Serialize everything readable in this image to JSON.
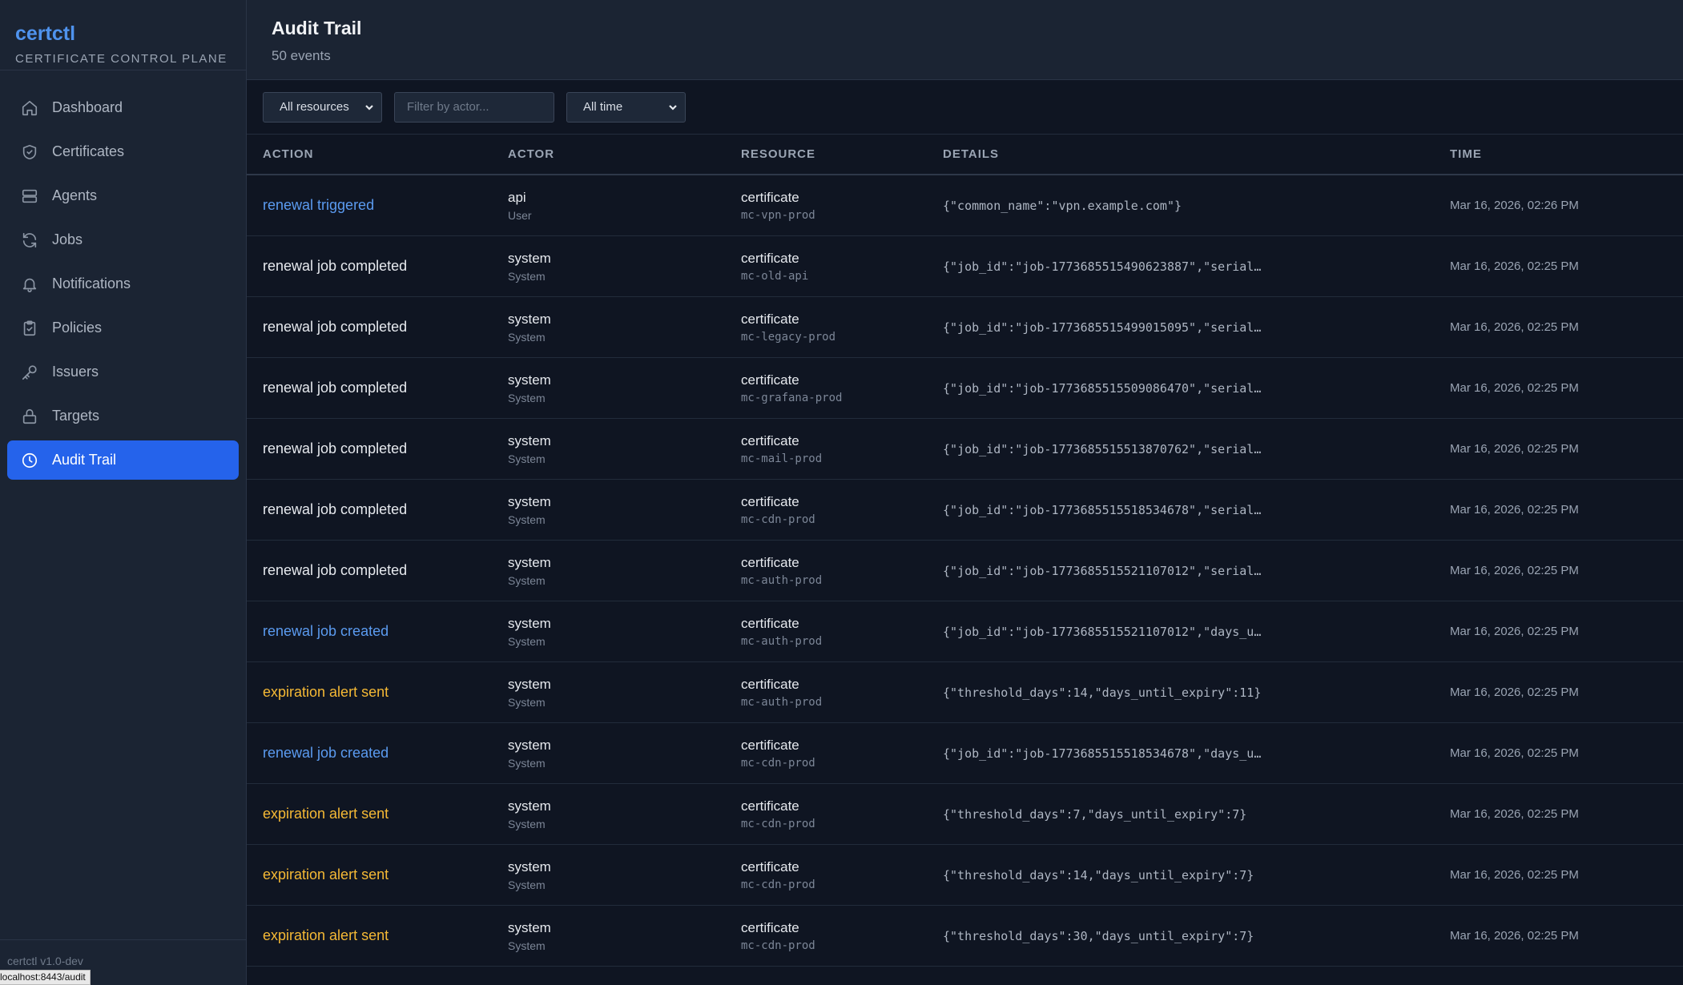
{
  "brand": {
    "title": "certctl",
    "subtitle": "CERTIFICATE CONTROL PLANE"
  },
  "sidebar": {
    "items": [
      {
        "label": "Dashboard",
        "icon": "home-icon",
        "active": false
      },
      {
        "label": "Certificates",
        "icon": "shield-icon",
        "active": false
      },
      {
        "label": "Agents",
        "icon": "server-icon",
        "active": false
      },
      {
        "label": "Jobs",
        "icon": "refresh-icon",
        "active": false
      },
      {
        "label": "Notifications",
        "icon": "bell-icon",
        "active": false
      },
      {
        "label": "Policies",
        "icon": "clipboard-icon",
        "active": false
      },
      {
        "label": "Issuers",
        "icon": "key-icon",
        "active": false
      },
      {
        "label": "Targets",
        "icon": "lock-icon",
        "active": false
      },
      {
        "label": "Audit Trail",
        "icon": "clock-icon",
        "active": true
      }
    ],
    "version": "certctl v1.0-dev",
    "status_url": "localhost:8443/audit"
  },
  "header": {
    "title": "Audit Trail",
    "subtitle": "50 events"
  },
  "filters": {
    "resource_value": "All resources",
    "actor_placeholder": "Filter by actor...",
    "time_value": "All time"
  },
  "table": {
    "columns": [
      "ACTION",
      "ACTOR",
      "RESOURCE",
      "DETAILS",
      "TIME"
    ],
    "rows": [
      {
        "action": "renewal triggered",
        "tone": "blue",
        "actor": "api",
        "actor_type": "User",
        "resource": "certificate",
        "resource_id": "mc-vpn-prod",
        "details": "{\"common_name\":\"vpn.example.com\"}",
        "time": "Mar 16, 2026, 02:26 PM"
      },
      {
        "action": "renewal job completed",
        "tone": "white",
        "actor": "system",
        "actor_type": "System",
        "resource": "certificate",
        "resource_id": "mc-old-api",
        "details": "{\"job_id\":\"job-1773685515490623887\",\"serial…",
        "time": "Mar 16, 2026, 02:25 PM"
      },
      {
        "action": "renewal job completed",
        "tone": "white",
        "actor": "system",
        "actor_type": "System",
        "resource": "certificate",
        "resource_id": "mc-legacy-prod",
        "details": "{\"job_id\":\"job-1773685515499015095\",\"serial…",
        "time": "Mar 16, 2026, 02:25 PM"
      },
      {
        "action": "renewal job completed",
        "tone": "white",
        "actor": "system",
        "actor_type": "System",
        "resource": "certificate",
        "resource_id": "mc-grafana-prod",
        "details": "{\"job_id\":\"job-1773685515509086470\",\"serial…",
        "time": "Mar 16, 2026, 02:25 PM"
      },
      {
        "action": "renewal job completed",
        "tone": "white",
        "actor": "system",
        "actor_type": "System",
        "resource": "certificate",
        "resource_id": "mc-mail-prod",
        "details": "{\"job_id\":\"job-1773685515513870762\",\"serial…",
        "time": "Mar 16, 2026, 02:25 PM"
      },
      {
        "action": "renewal job completed",
        "tone": "white",
        "actor": "system",
        "actor_type": "System",
        "resource": "certificate",
        "resource_id": "mc-cdn-prod",
        "details": "{\"job_id\":\"job-1773685515518534678\",\"serial…",
        "time": "Mar 16, 2026, 02:25 PM"
      },
      {
        "action": "renewal job completed",
        "tone": "white",
        "actor": "system",
        "actor_type": "System",
        "resource": "certificate",
        "resource_id": "mc-auth-prod",
        "details": "{\"job_id\":\"job-1773685515521107012\",\"serial…",
        "time": "Mar 16, 2026, 02:25 PM"
      },
      {
        "action": "renewal job created",
        "tone": "blue",
        "actor": "system",
        "actor_type": "System",
        "resource": "certificate",
        "resource_id": "mc-auth-prod",
        "details": "{\"job_id\":\"job-1773685515521107012\",\"days_u…",
        "time": "Mar 16, 2026, 02:25 PM"
      },
      {
        "action": "expiration alert sent",
        "tone": "amber",
        "actor": "system",
        "actor_type": "System",
        "resource": "certificate",
        "resource_id": "mc-auth-prod",
        "details": "{\"threshold_days\":14,\"days_until_expiry\":11}",
        "time": "Mar 16, 2026, 02:25 PM"
      },
      {
        "action": "renewal job created",
        "tone": "blue",
        "actor": "system",
        "actor_type": "System",
        "resource": "certificate",
        "resource_id": "mc-cdn-prod",
        "details": "{\"job_id\":\"job-1773685515518534678\",\"days_u…",
        "time": "Mar 16, 2026, 02:25 PM"
      },
      {
        "action": "expiration alert sent",
        "tone": "amber",
        "actor": "system",
        "actor_type": "System",
        "resource": "certificate",
        "resource_id": "mc-cdn-prod",
        "details": "{\"threshold_days\":7,\"days_until_expiry\":7}",
        "time": "Mar 16, 2026, 02:25 PM"
      },
      {
        "action": "expiration alert sent",
        "tone": "amber",
        "actor": "system",
        "actor_type": "System",
        "resource": "certificate",
        "resource_id": "mc-cdn-prod",
        "details": "{\"threshold_days\":14,\"days_until_expiry\":7}",
        "time": "Mar 16, 2026, 02:25 PM"
      },
      {
        "action": "expiration alert sent",
        "tone": "amber",
        "actor": "system",
        "actor_type": "System",
        "resource": "certificate",
        "resource_id": "mc-cdn-prod",
        "details": "{\"threshold_days\":30,\"days_until_expiry\":7}",
        "time": "Mar 16, 2026, 02:25 PM"
      }
    ]
  },
  "colors": {
    "accent": "#2563eb",
    "link_blue": "#5b9bf0",
    "alert_amber": "#f5b935",
    "background": "#0f1522",
    "sidebar": "#1b2433"
  }
}
